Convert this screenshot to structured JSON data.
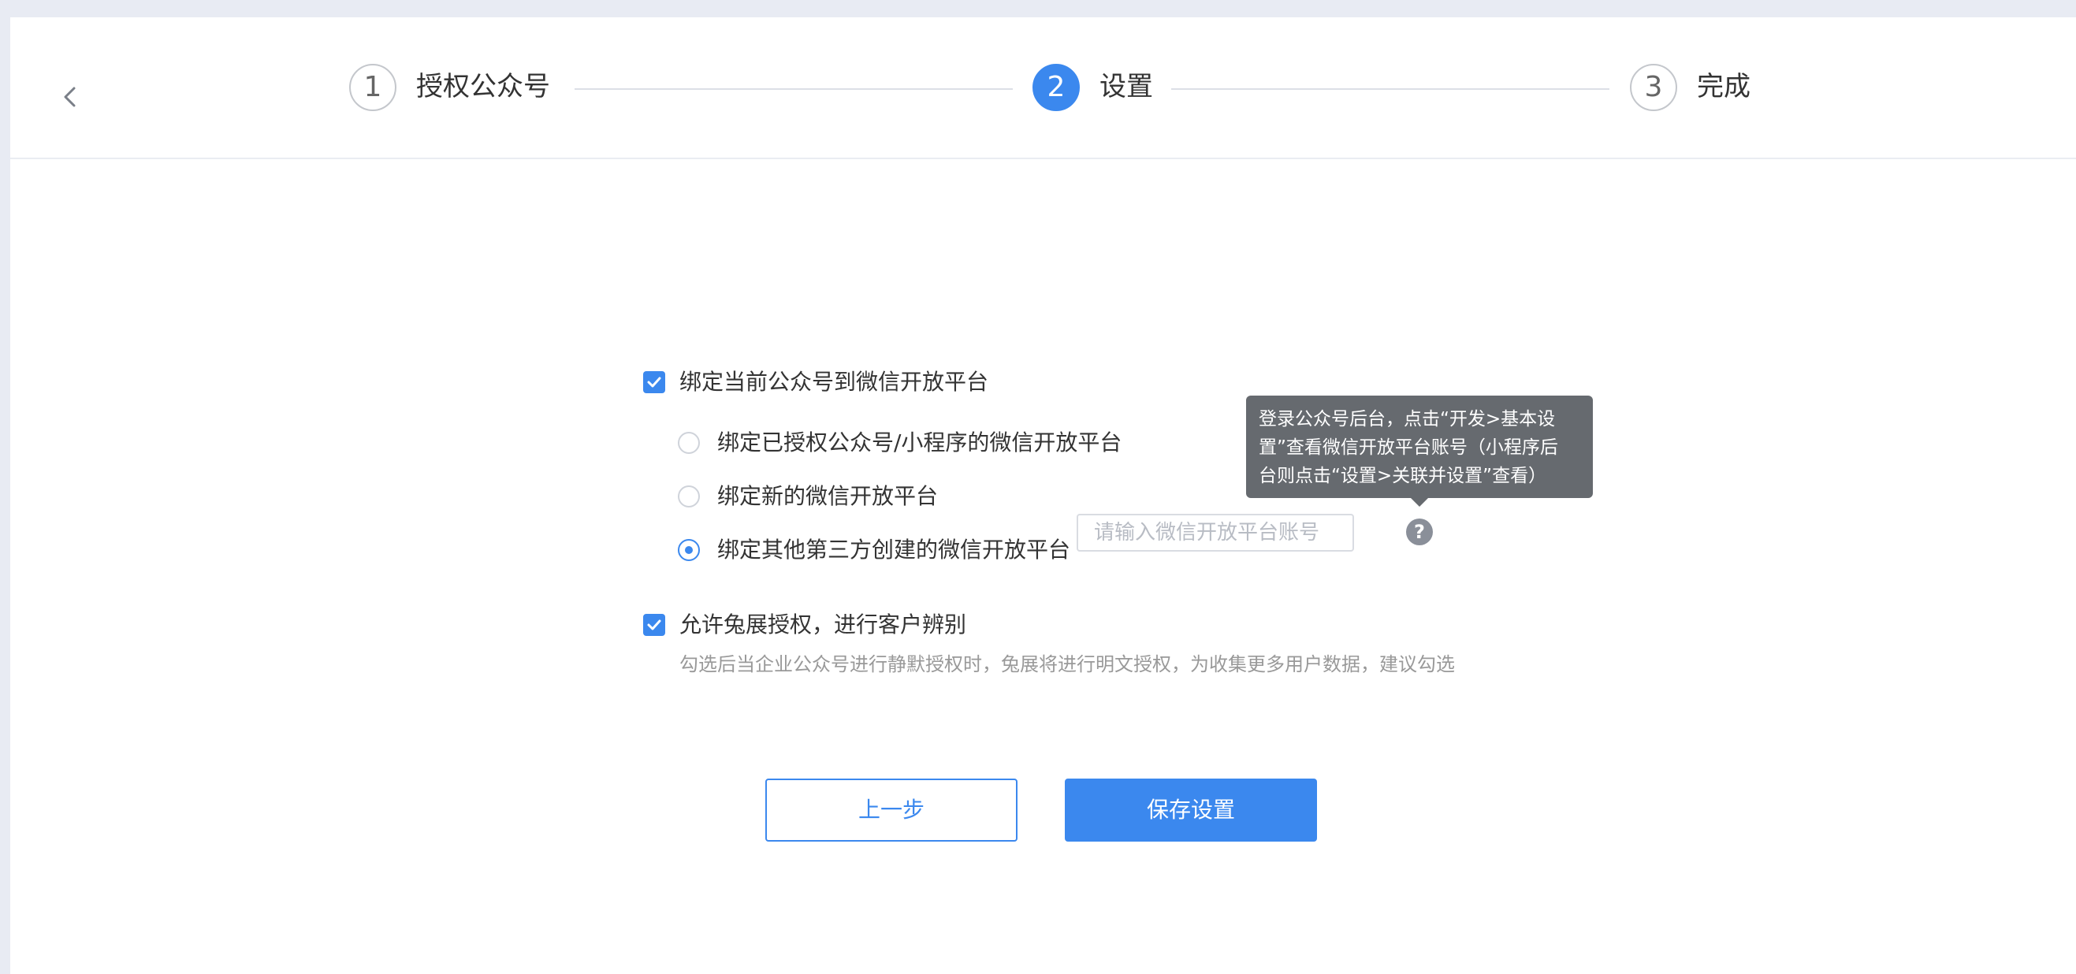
{
  "steps": [
    {
      "number": "1",
      "label": "授权公众号"
    },
    {
      "number": "2",
      "label": "设置"
    },
    {
      "number": "3",
      "label": "完成"
    }
  ],
  "active_step": 2,
  "options": {
    "bind_platform": {
      "label": "绑定当前公众号到微信开放平台",
      "checked": true
    },
    "radio_existing": {
      "label": "绑定已授权公众号/小程序的微信开放平台",
      "checked": false
    },
    "radio_new": {
      "label": "绑定新的微信开放平台",
      "checked": false
    },
    "radio_other": {
      "label": "绑定其他第三方创建的微信开放平台",
      "checked": true
    },
    "account_input": {
      "placeholder": "请输入微信开放平台账号",
      "value": ""
    },
    "allow_auth": {
      "label": "允许兔展授权，进行客户辨别",
      "checked": true
    },
    "allow_auth_hint": "勾选后当企业公众号进行静默授权时，兔展将进行明文授权，为收集更多用户数据，建议勾选"
  },
  "tooltip": {
    "lines": [
      "登录公众号后台，点击“开发>基本设",
      "置”查看微信开放平台账号（小程序后",
      "台则点击“设置>关联并设置”查看）"
    ]
  },
  "help_icon": "question-icon",
  "buttons": {
    "prev": "上一步",
    "save": "保存设置"
  },
  "colors": {
    "accent": "#3b88ee",
    "page_bg": "#e8ebf3",
    "tooltip_bg": "#666a6f"
  }
}
